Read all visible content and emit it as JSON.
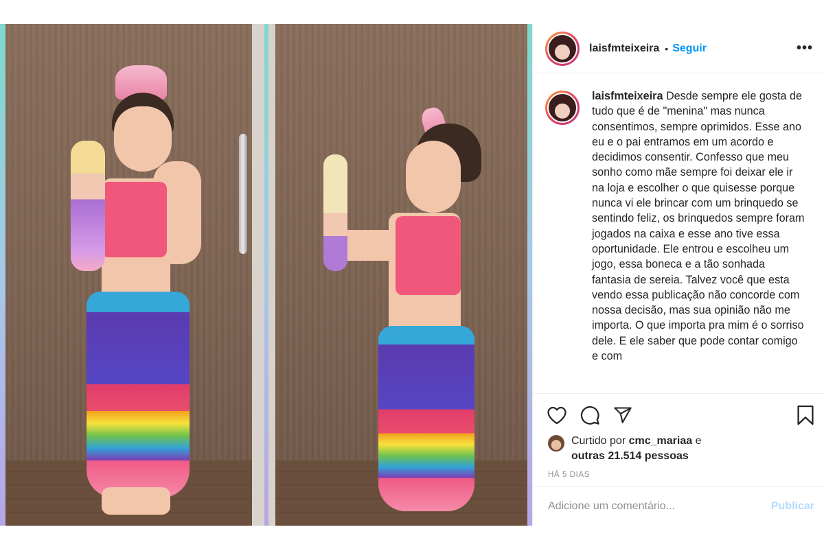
{
  "post": {
    "photo_alt": "",
    "header": {
      "username": "laisfmteixeira",
      "separator": "•",
      "follow_label": "Seguir",
      "more_label": "•••"
    },
    "caption": {
      "username": "laisfmteixeira",
      "text": "Desde sempre ele gosta de tudo que é de \"menina\" mas nunca consentimos, sempre oprimidos. Esse ano eu e o pai entramos em um acordo e decidimos consentir. Confesso que meu sonho como mãe sempre foi deixar ele ir na loja e escolher o que quisesse porque nunca vi ele brincar com um brinquedo se sentindo feliz, os brinquedos sempre foram jogados na caixa e esse ano tive essa oportunidade. Ele entrou e escolheu um jogo, essa boneca e a tão sonhada fantasia de sereia. Talvez você que esta vendo essa publicação não concorde com nossa decisão, mas sua opinião não me importa. O que importa pra mim é o sorriso dele. E ele saber que pode contar comigo e com"
    },
    "likes": {
      "prefix": "Curtido por",
      "user": "cmc_mariaa",
      "conj": "e",
      "others": "outras 21.514 pessoas"
    },
    "time_ago": "HÁ 5 DIAS",
    "comment": {
      "placeholder": "Adicione um comentário...",
      "publish_label": "Publicar"
    },
    "icons": [
      "heart-icon",
      "comment-icon",
      "share-icon",
      "bookmark-icon"
    ],
    "colors": {
      "link_blue": "#0095f6",
      "publish_disabled": "#b3dbff",
      "text": "#262626",
      "muted": "#8e8e8e"
    }
  }
}
